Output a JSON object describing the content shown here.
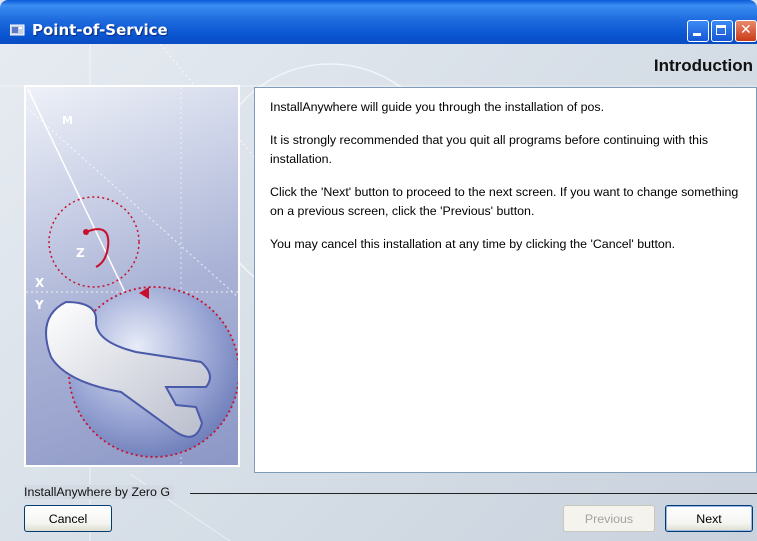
{
  "window": {
    "title": "Point-of-Service",
    "icon": "installer-app-icon",
    "controls": [
      "minimize-icon",
      "maximize-icon",
      "close-icon"
    ]
  },
  "heading": "Introduction",
  "side_panel": {
    "image": "installanywhere-wrench-graphic",
    "letters": [
      "M",
      "Z",
      "X",
      "Y"
    ]
  },
  "content": {
    "paragraphs": [
      "InstallAnywhere will guide you through the installation of pos.",
      "It is strongly recommended that you quit all programs before continuing with this installation.",
      "Click the 'Next' button to proceed to the next screen. If you want to change something on a previous screen, click the 'Previous' button.",
      "You may cancel this installation at any time by clicking the 'Cancel' button."
    ]
  },
  "footer": {
    "branding": "InstallAnywhere by Zero G",
    "cancel_label": "Cancel",
    "previous_label": "Previous",
    "next_label": "Next",
    "previous_enabled": false
  },
  "colors": {
    "titlebar": "#0a55d1",
    "accent_red": "#c8102e",
    "panel_border": "#7f9db9"
  }
}
